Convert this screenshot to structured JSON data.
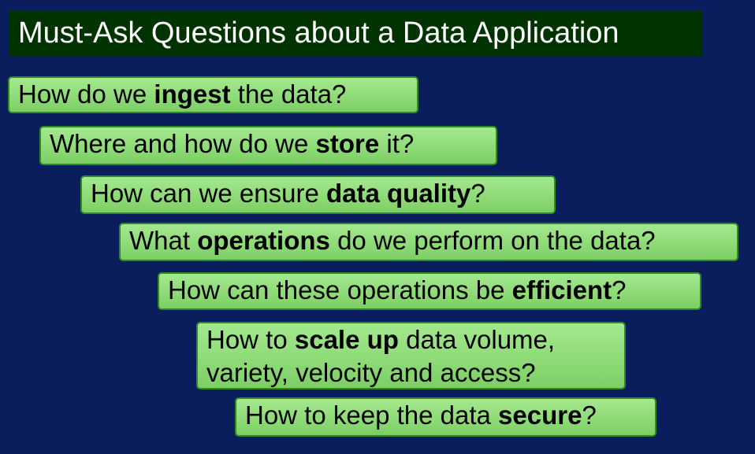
{
  "title": "Must-Ask Questions about a Data Application",
  "questions": [
    {
      "before": "How do we ",
      "bold": "ingest",
      "after": " the data?"
    },
    {
      "before": "Where and how do we ",
      "bold": "store",
      "after": " it?"
    },
    {
      "before": "How can we ensure ",
      "bold": "data quality",
      "after": "?"
    },
    {
      "before": "What ",
      "bold": "operations",
      "after": " do we perform on the data?"
    },
    {
      "before": "How can these operations be ",
      "bold": "efficient",
      "after": "?"
    },
    {
      "before": "How to ",
      "bold": "scale up",
      "after": " data volume,",
      "line2": "variety, velocity and access?"
    },
    {
      "before": "How to keep the data ",
      "bold": "secure",
      "after": "?"
    }
  ],
  "colors": {
    "background": "#0a1d5c",
    "title_background": "#003300",
    "box_fill": "#8fdb78",
    "box_border": "#2f8a22"
  }
}
